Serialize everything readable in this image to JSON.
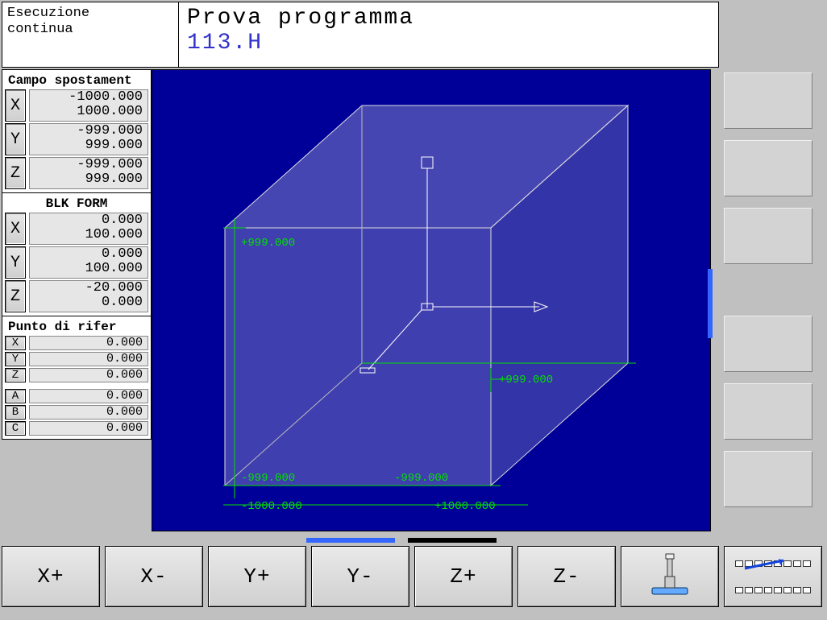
{
  "header": {
    "mode_line1": "Esecuzione",
    "mode_line2": "continua",
    "title": "Prova programma",
    "file": "113.H"
  },
  "left": {
    "traverse": {
      "heading": "Campo spostament",
      "X": {
        "min": "-1000.000",
        "max": "1000.000"
      },
      "Y": {
        "min": "-999.000",
        "max": "999.000"
      },
      "Z": {
        "min": "-999.000",
        "max": "999.000"
      }
    },
    "blkform": {
      "heading": "BLK FORM",
      "X": {
        "min": "0.000",
        "max": "100.000"
      },
      "Y": {
        "min": "0.000",
        "max": "100.000"
      },
      "Z": {
        "min": "-20.000",
        "max": "0.000"
      }
    },
    "datum": {
      "heading": "Punto di rifer",
      "X": "0.000",
      "Y": "0.000",
      "Z": "0.000",
      "A": "0.000",
      "B": "0.000",
      "C": "0.000"
    }
  },
  "viewport_labels": {
    "top_y": "+999.000",
    "bot_y": "-999.000",
    "mid_x": "-999.000",
    "right_x": "+999.000",
    "floor_left": "-1000.000",
    "floor_right": "+1000.000"
  },
  "softkeys": {
    "k1": "X+",
    "k2": "X-",
    "k3": "Y+",
    "k4": "Y-",
    "k5": "Z+",
    "k6": "Z-"
  }
}
